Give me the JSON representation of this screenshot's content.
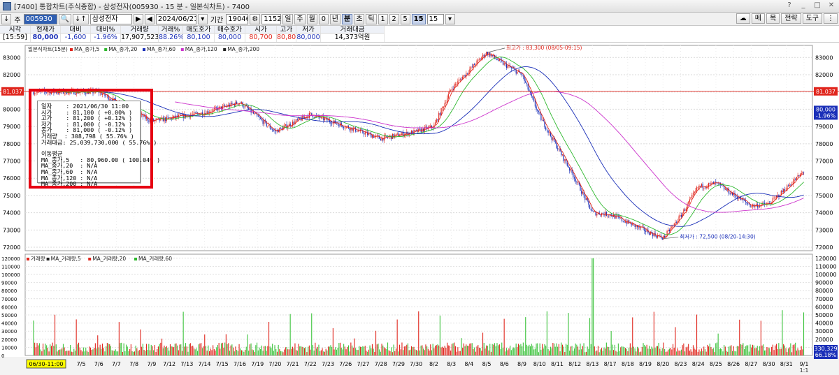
{
  "window": {
    "title": "[7400] 통합차트(주식종합) - 삼성전자(005930 - 15 분 - 일본식차트) - 7400",
    "buttons": [
      "?",
      "_",
      "□",
      "✕"
    ]
  },
  "toolbar": {
    "code": "005930",
    "name": "삼성전자",
    "date": "2024/06/21",
    "period_label": "기간",
    "period_value": "19046",
    "count_value": "1152",
    "period_buttons": [
      "일",
      "주",
      "월",
      "0",
      "년",
      "분",
      "초",
      "틱"
    ],
    "minute_buttons": [
      "1",
      "2",
      "5",
      "15"
    ],
    "selected_minute": "15",
    "minute_dropdown": "15",
    "right_buttons": [
      "메",
      "목",
      "전략",
      "도구"
    ]
  },
  "quote": {
    "headers": [
      "시각",
      "현재가",
      "대비",
      "대비%",
      "거래량",
      "거래%",
      "매도호가",
      "매수호가",
      "시가",
      "고가",
      "저가",
      "거래대금"
    ],
    "values": [
      "[15:59]",
      "80,000",
      "-1,600",
      "-1.96%",
      "17,907,523",
      "88.26%",
      "80,100",
      "80,000",
      "80,700",
      "80,800",
      "80,000",
      "14,373억원"
    ]
  },
  "price_panel": {
    "legend": [
      "일본식차트(15분)",
      "MA_종가,5",
      "MA_종가,20",
      "MA_종가,60",
      "MA_종가,120",
      "MA_종가,200"
    ],
    "legend_colors": [
      "#222222",
      "#e0261d",
      "#2eb82e",
      "#1a2fb8",
      "#cc33cc"
    ],
    "y_ticks": [
      "83000",
      "82000",
      "81000",
      "80000",
      "79000",
      "78000",
      "77000",
      "76000",
      "75000",
      "74000",
      "73000",
      "72000"
    ],
    "crosshair_price": "81,037",
    "current_price_tag": "80,000",
    "current_pct_tag": "-1.96%",
    "high_annotation": "최고가 : 83,300 (08/05-09:15)",
    "low_annotation": "최저가 : 72,500 (08/20-14:30)"
  },
  "volume_panel": {
    "legend": [
      "거래량",
      "MA_거래량,5",
      "MA_거래량,20",
      "MA_거래량,60"
    ],
    "legend_colors": [
      "#e0261d",
      "#222222",
      "#e0261d",
      "#2eb82e"
    ],
    "y_ticks": [
      "120000",
      "110000",
      "100000",
      "90000",
      "80000",
      "70000",
      "60000",
      "50000",
      "40000",
      "30000",
      "20000",
      "10000"
    ],
    "left_ticks": [
      "120000",
      "110000",
      "100000",
      "90000",
      "80000",
      "70000",
      "60000",
      "50000",
      "40000",
      "30000",
      "20000",
      "10000",
      "0"
    ],
    "volume_tag": "330,329",
    "volume_pct_tag": "66.18%"
  },
  "x_axis": {
    "cursor_label": "06/30-11:00",
    "labels": [
      "7/5",
      "7/6",
      "7/7",
      "7/8",
      "7/9",
      "7/12",
      "7/13",
      "7/14",
      "7/15",
      "7/16",
      "7/19",
      "7/20",
      "7/21",
      "7/22",
      "7/23",
      "7/26",
      "7/27",
      "7/28",
      "7/29",
      "7/30",
      "8/2",
      "8/3",
      "8/4",
      "8/5",
      "8/6",
      "8/9",
      "8/10",
      "8/11",
      "8/12",
      "8/13",
      "8/17",
      "8/18",
      "8/19",
      "8/20",
      "8/23",
      "8/24",
      "8/25",
      "8/26",
      "8/27",
      "8/30",
      "8/31",
      "9/1"
    ]
  },
  "info_box": {
    "lines": [
      "일자    : 2021/06/30 11:00",
      "시가    : 81,100 ( +0.00% )",
      "고가    : 81,200 ( +0.12% )",
      "저가    : 81,000 ( -0.12% )",
      "종가    : 81,000 ( -0.12% )",
      "거래량  : 308,798 ( 55.76% )",
      "거래대금: 25,039,730,000 ( 55.76% )"
    ],
    "ma_title": "이동평균",
    "ma_lines": [
      "MA_종가,5   : 80,960.00 ( 100.04% )",
      "MA_종가,20  : N/A",
      "MA_종가,60  : N/A",
      "MA_종가,120 : N/A",
      "MA_종가,200 : N/A"
    ]
  },
  "bottom_controls": {
    "zoom": "1:1"
  },
  "colors": {
    "up": "#e0261d",
    "down": "#1a2fb8",
    "crosshair": "#e0261d",
    "highlight": "#e60012"
  },
  "chart_data": {
    "type": "candlestick",
    "price_key_points": [
      {
        "x": "6/30",
        "price": 81000
      },
      {
        "x": "7/6",
        "price": 81000
      },
      {
        "x": "7/9",
        "price": 79300
      },
      {
        "x": "7/14",
        "price": 79800
      },
      {
        "x": "7/16",
        "price": 80400
      },
      {
        "x": "7/20",
        "price": 78700
      },
      {
        "x": "7/22",
        "price": 79700
      },
      {
        "x": "7/28",
        "price": 78300
      },
      {
        "x": "7/30",
        "price": 78700
      },
      {
        "x": "8/2",
        "price": 79000
      },
      {
        "x": "8/3",
        "price": 81200
      },
      {
        "x": "8/5",
        "price": 83300
      },
      {
        "x": "8/6",
        "price": 82600
      },
      {
        "x": "8/9",
        "price": 82000
      },
      {
        "x": "8/10",
        "price": 79600
      },
      {
        "x": "8/12",
        "price": 76000
      },
      {
        "x": "8/13",
        "price": 74000
      },
      {
        "x": "8/17",
        "price": 73900
      },
      {
        "x": "8/20",
        "price": 72500
      },
      {
        "x": "8/23",
        "price": 73800
      },
      {
        "x": "8/24",
        "price": 75500
      },
      {
        "x": "8/25",
        "price": 75700
      },
      {
        "x": "8/27",
        "price": 74400
      },
      {
        "x": "8/30",
        "price": 74500
      },
      {
        "x": "9/1",
        "price": 76400
      }
    ],
    "high": 83300,
    "low": 72500,
    "ylim": [
      71800,
      83700
    ]
  }
}
